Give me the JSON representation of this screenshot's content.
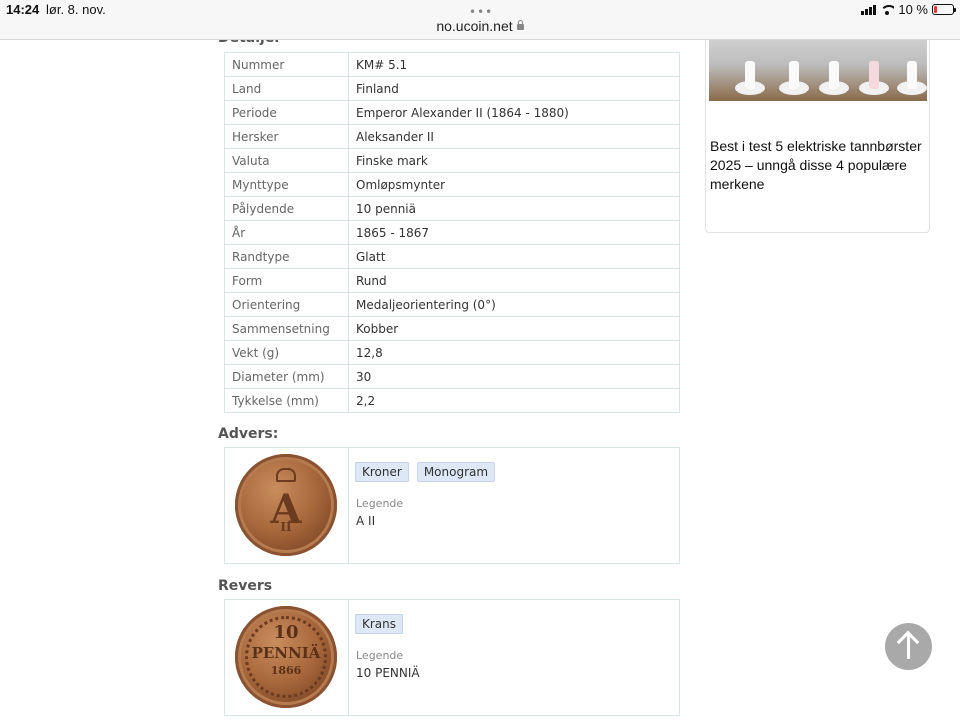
{
  "status_bar": {
    "time": "14:24",
    "date": "lør. 8. nov.",
    "url": "no.ucoin.net",
    "dots": "•••",
    "battery": "10 %",
    "battery_color": "#e53935"
  },
  "details": {
    "title": "Detaljer",
    "rows": [
      {
        "key": "Nummer",
        "value": "KM# 5.1"
      },
      {
        "key": "Land",
        "value": "Finland"
      },
      {
        "key": "Periode",
        "value": "Emperor Alexander II (1864 - 1880)"
      },
      {
        "key": "Hersker",
        "value": "Aleksander II"
      },
      {
        "key": "Valuta",
        "value": "Finske mark"
      },
      {
        "key": "Mynttype",
        "value": "Omløpsmynter"
      },
      {
        "key": "Pålydende",
        "value": "10 penniä"
      },
      {
        "key": "År",
        "value": "1865 - 1867"
      },
      {
        "key": "Randtype",
        "value": "Glatt"
      },
      {
        "key": "Form",
        "value": "Rund"
      },
      {
        "key": "Orientering",
        "value": "Medaljeorientering (0°)"
      },
      {
        "key": "Sammensetning",
        "value": "Kobber"
      },
      {
        "key": "Vekt (g)",
        "value": "12,8"
      },
      {
        "key": "Diameter (mm)",
        "value": "30"
      },
      {
        "key": "Tykkelse (mm)",
        "value": "2,2"
      }
    ]
  },
  "obverse": {
    "title": "Advers:",
    "tags": [
      "Kroner",
      "Monogram"
    ],
    "legend_label": "Legende",
    "legend_value": "A II"
  },
  "reverse": {
    "title": "Revers",
    "tags": [
      "Krans"
    ],
    "legend_label": "Legende",
    "legend_value": "10 PENNIÄ"
  },
  "ad": {
    "headline": "Best i test 5 elektriske tannbørster 2025 – unngå disse 4 populære merkene"
  }
}
